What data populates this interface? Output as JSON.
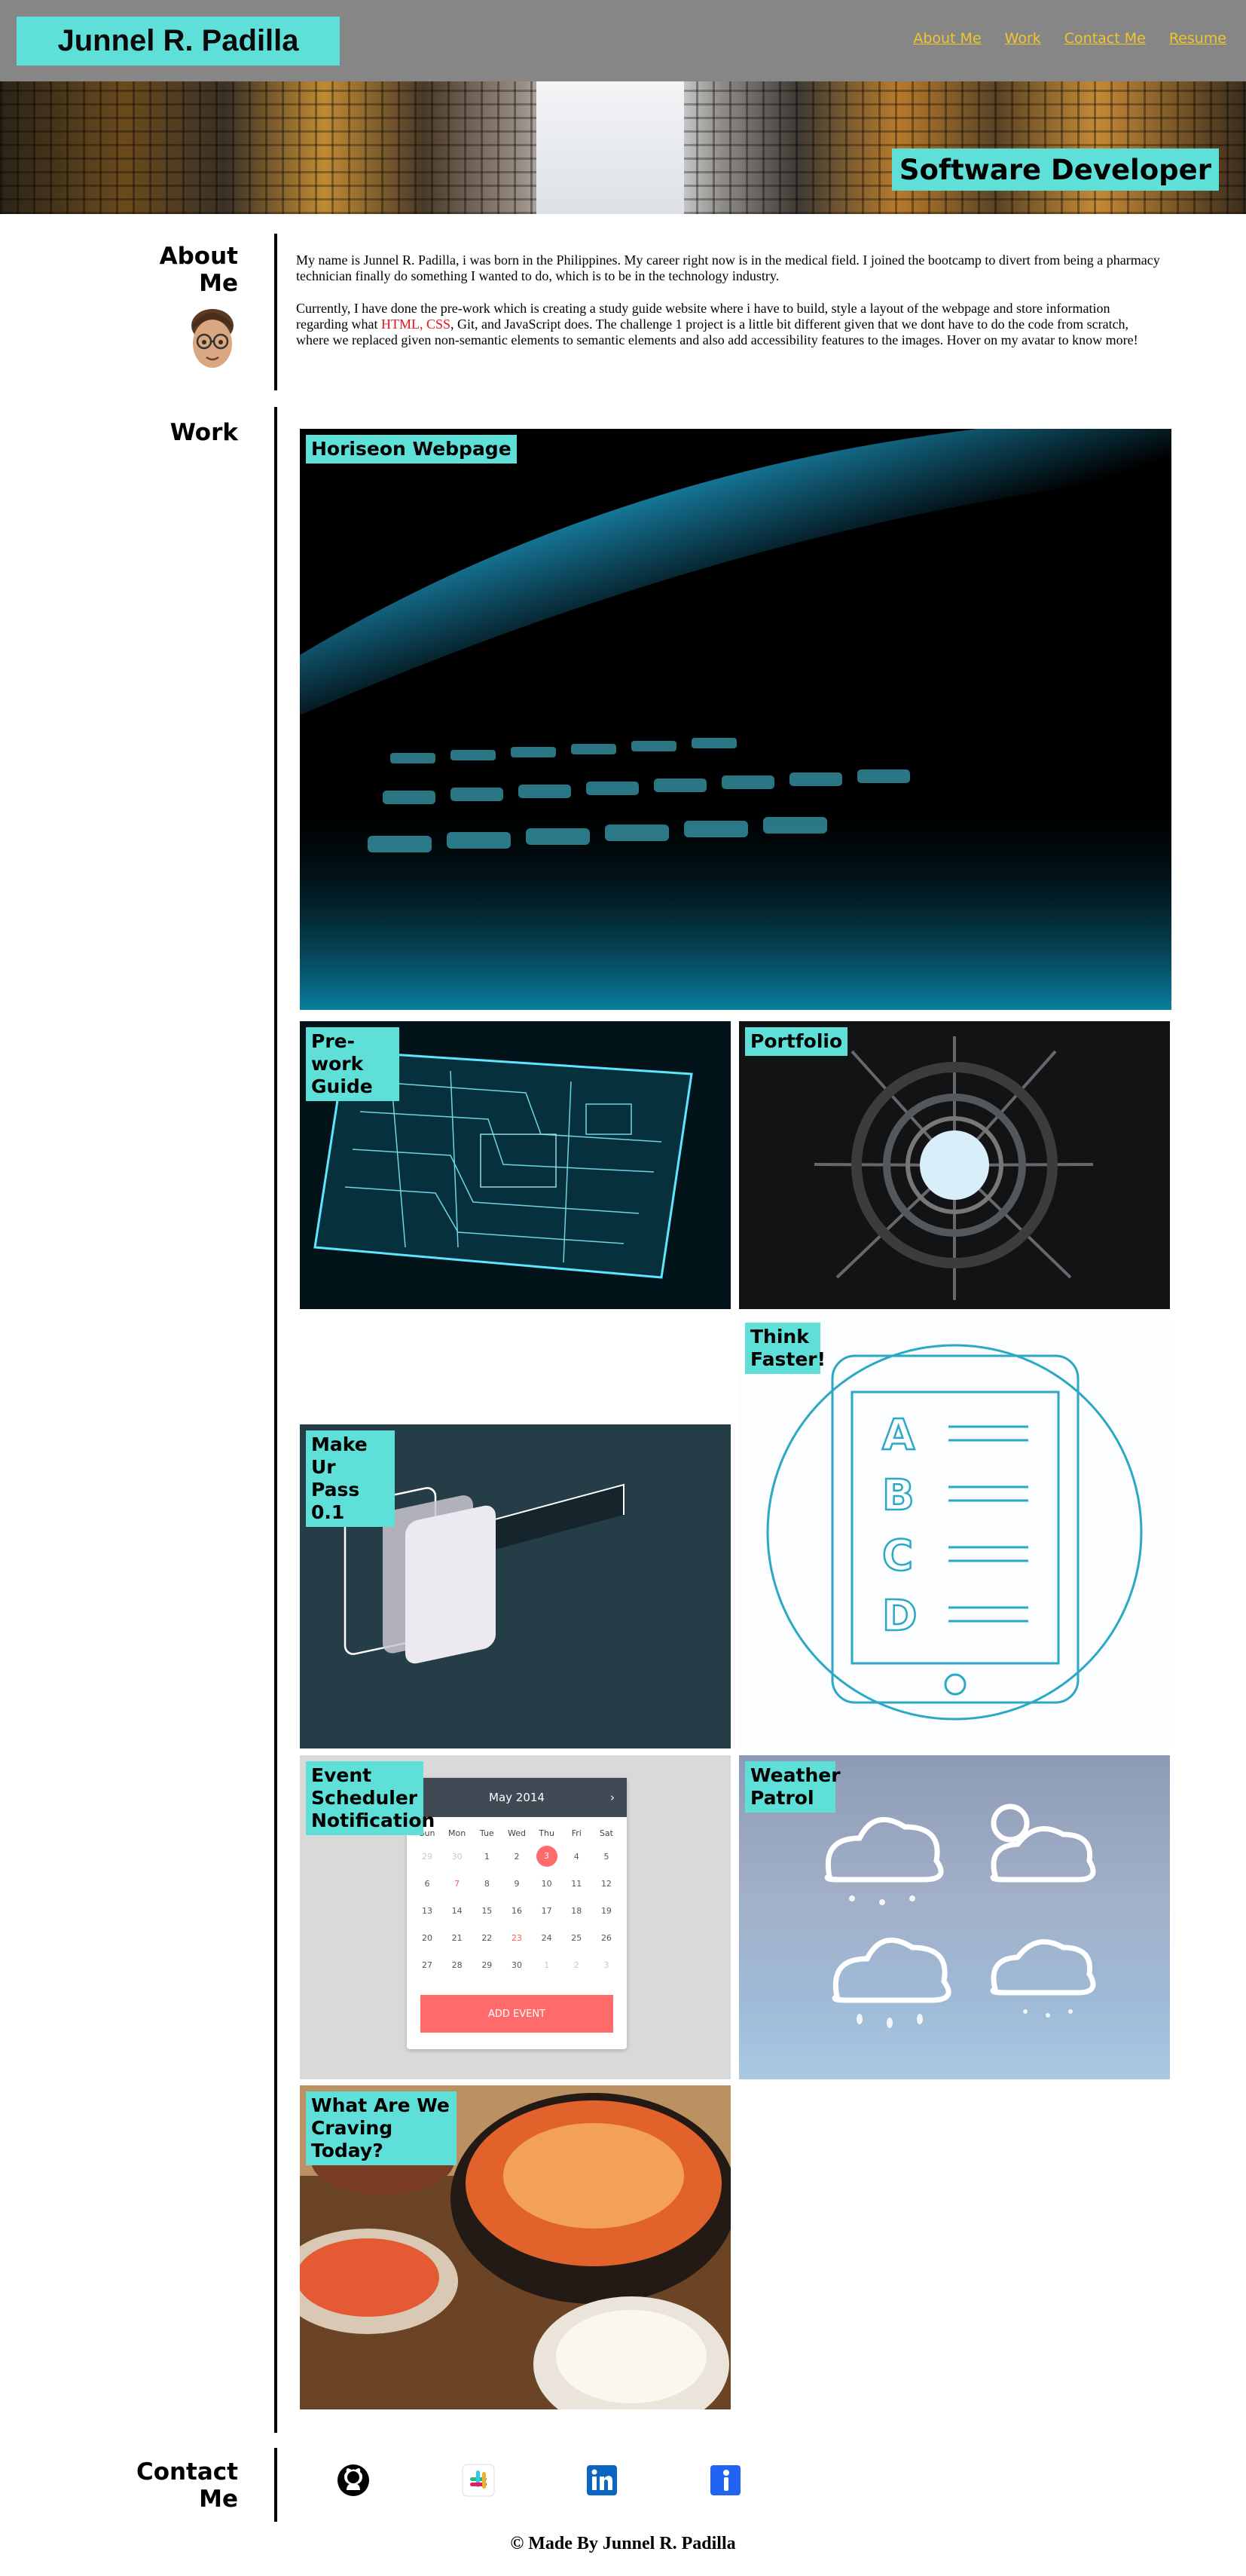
{
  "header": {
    "brand": "Junnel R. Padilla",
    "nav": [
      "About Me",
      "Work",
      "Contact Me",
      "Resume"
    ]
  },
  "hero": {
    "title": "Software Developer"
  },
  "about": {
    "heading": "About Me",
    "paragraph1": "My name is Junnel R. Padilla, i was born in the Philippines. My career right now is in the medical field. I joined the bootcamp to divert from being a pharmacy technician finally do something I wanted to do, which is to be in the technology industry.",
    "paragraph2_before": "Currently, I have done the pre-work which is creating a study guide website where i have to build, style a layout of the webpage and store information regarding what ",
    "paragraph2_highlight": "HTML, CSS",
    "paragraph2_after": ", Git, and JavaScript does. The challenge 1 project is a little bit different given that we dont have to do the code from scratch, where we replaced given non-semantic elements to semantic elements and also add accessibility features to the images. Hover on my avatar to know more!",
    "avatar_icon": "memoji-avatar-icon"
  },
  "work": {
    "heading": "Work",
    "projects": [
      "Horiseon Webpage",
      "Pre-work Guide",
      "Portfolio",
      "Think Faster!",
      "Make Ur Pass 0.1",
      "Event Scheduler Notification",
      "Weather Patrol",
      "What Are We Craving Today?"
    ],
    "calendar": {
      "month": "May 2014",
      "days": [
        "Sun",
        "Mon",
        "Tue",
        "Wed",
        "Thu",
        "Fri",
        "Sat"
      ],
      "weeks": [
        [
          "29",
          "30",
          "1",
          "2",
          "3",
          "4",
          "5"
        ],
        [
          "6",
          "7",
          "8",
          "9",
          "10",
          "11",
          "12"
        ],
        [
          "13",
          "14",
          "15",
          "16",
          "17",
          "18",
          "19"
        ],
        [
          "20",
          "21",
          "22",
          "23",
          "24",
          "25",
          "26"
        ],
        [
          "27",
          "28",
          "29",
          "30",
          "1",
          "2",
          "3"
        ]
      ],
      "button": "ADD EVENT"
    },
    "quiz_letters": [
      "A",
      "B",
      "C",
      "D"
    ]
  },
  "contact": {
    "heading": "Contact Me",
    "icons": [
      "github-icon",
      "slack-icon",
      "linkedin-icon",
      "indeed-icon"
    ]
  },
  "footer": "© Made By Junnel R. Padilla",
  "colors": {
    "accent": "#5edfd8",
    "header_bg": "#868686",
    "nav_link": "#f0c52c",
    "highlight": "#e8121c"
  }
}
